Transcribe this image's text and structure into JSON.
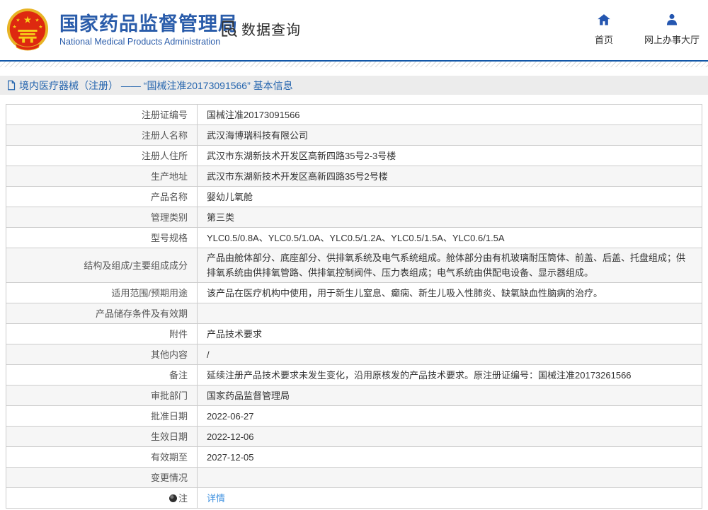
{
  "header": {
    "org_name_cn": "国家药品监督管理局",
    "org_name_en": "National Medical Products Administration",
    "section_title": "数据查询",
    "nav": [
      {
        "icon": "home-icon",
        "label": "首页"
      },
      {
        "icon": "person-icon",
        "label": "网上办事大厅"
      }
    ]
  },
  "breadcrumb": {
    "text": "境内医疗器械（注册） —— “国械注准20173091566” 基本信息"
  },
  "table": {
    "rows": [
      {
        "label": "注册证编号",
        "value": "国械注准20173091566"
      },
      {
        "label": "注册人名称",
        "value": "武汉海博瑞科技有限公司"
      },
      {
        "label": "注册人住所",
        "value": "武汉市东湖新技术开发区高新四路35号2-3号楼"
      },
      {
        "label": "生产地址",
        "value": "武汉市东湖新技术开发区高新四路35号2号楼"
      },
      {
        "label": "产品名称",
        "value": "婴幼儿氧舱"
      },
      {
        "label": "管理类别",
        "value": "第三类"
      },
      {
        "label": "型号规格",
        "value": "YLC0.5/0.8A、YLC0.5/1.0A、YLC0.5/1.2A、YLC0.5/1.5A、YLC0.6/1.5A"
      },
      {
        "label": "结构及组成/主要组成成分",
        "value": "产品由舱体部分、底座部分、供排氧系统及电气系统组成。舱体部分由有机玻璃耐压筒体、前盖、后盖、托盘组成；供排氧系统由供排氧管路、供排氧控制阀件、压力表组成；电气系统由供配电设备、显示器组成。"
      },
      {
        "label": "适用范围/预期用途",
        "value": "该产品在医疗机构中使用，用于新生儿窒息、癫痫、新生儿吸入性肺炎、缺氧缺血性脑病的治疗。"
      },
      {
        "label": "产品储存条件及有效期",
        "value": ""
      },
      {
        "label": "附件",
        "value": "产品技术要求"
      },
      {
        "label": "其他内容",
        "value": "/"
      },
      {
        "label": "备注",
        "value": "延续注册产品技术要求未发生变化，沿用原核发的产品技术要求。原注册证编号：国械注准20173261566"
      },
      {
        "label": "审批部门",
        "value": "国家药品监督管理局"
      },
      {
        "label": "批准日期",
        "value": "2022-06-27"
      },
      {
        "label": "生效日期",
        "value": "2022-12-06"
      },
      {
        "label": "有效期至",
        "value": "2027-12-05"
      },
      {
        "label": "变更情况",
        "value": ""
      },
      {
        "label": "注",
        "value": "详情",
        "link": true,
        "label_icon": "note-icon"
      }
    ]
  },
  "colors": {
    "brand_blue": "#2a5caa",
    "rule_blue": "#1257a8",
    "breadcrumb_text": "#2565ae",
    "link_blue": "#4293e0",
    "row_alt_bg": "#f6f6f6",
    "table_border": "#cccccc",
    "emblem_red": "#de2910",
    "emblem_gold": "#f7d019"
  }
}
